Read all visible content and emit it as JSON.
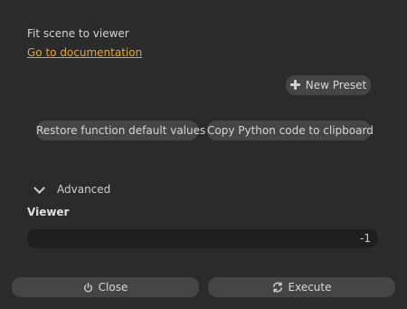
{
  "header": {
    "description": "Fit scene to viewer",
    "doc_link": "Go to documentation"
  },
  "presets": {
    "new_preset_label": "New Preset",
    "new_preset_icon": "plus-icon"
  },
  "actions": {
    "restore_label": "Restore function default values",
    "copy_python_label": "Copy Python code to clipboard"
  },
  "advanced": {
    "label": "Advanced",
    "expanded": true,
    "toggle_icon": "chevron-down-icon"
  },
  "fields": {
    "viewer": {
      "label": "Viewer",
      "value": "-1"
    }
  },
  "footer": {
    "close_label": "Close",
    "close_icon": "power-icon",
    "execute_label": "Execute",
    "execute_icon": "refresh-icon"
  },
  "colors": {
    "background": "#2b2b2b",
    "button": "#454545",
    "field": "#1f1f1f",
    "link": "#f0a020"
  }
}
